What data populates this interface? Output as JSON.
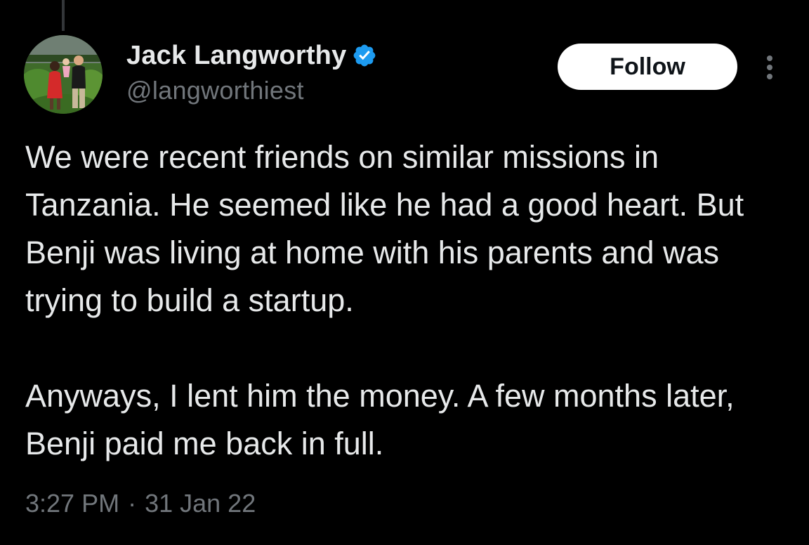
{
  "author": {
    "display_name": "Jack Langworthy",
    "handle": "@langworthiest",
    "verified": true,
    "avatar_icon": "profile-photo"
  },
  "actions": {
    "follow_label": "Follow",
    "more_icon": "more-vertical-icon"
  },
  "tweet": {
    "paragraph_1": "We were recent friends on similar missions in Tanzania. He seemed like he had a good heart. But Benji was living at home with his parents and was trying to build a startup.",
    "paragraph_2": "Anyways, I lent him the money. A few months later, Benji paid me back in full."
  },
  "meta": {
    "time": "3:27 PM",
    "separator": "·",
    "date": "31 Jan 22"
  },
  "colors": {
    "background": "#000000",
    "text_primary": "#e7e9ea",
    "text_secondary": "#71767b",
    "verified_blue": "#1d9bf0",
    "follow_bg": "#ffffff"
  }
}
